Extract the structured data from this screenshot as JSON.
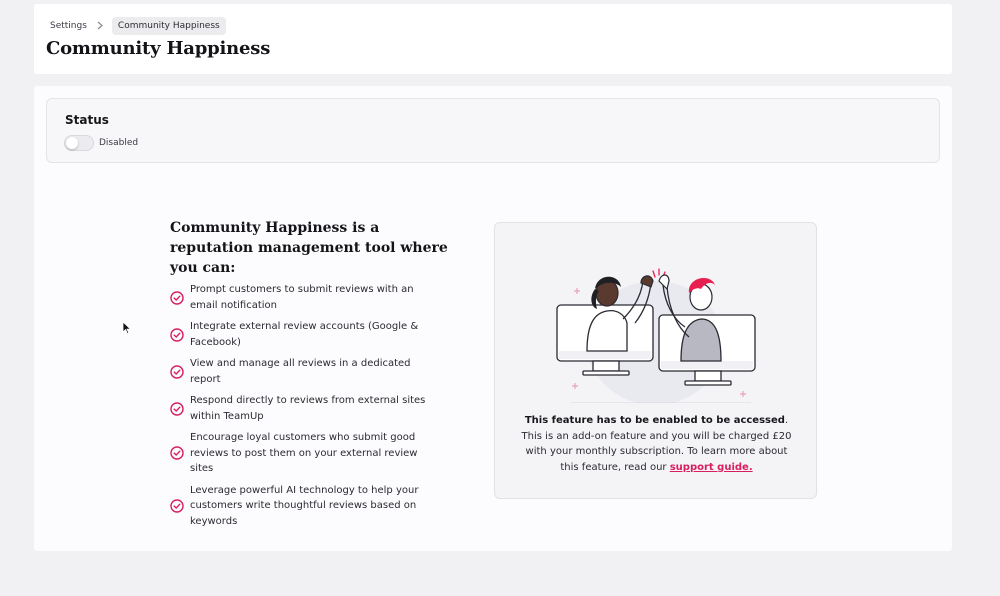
{
  "breadcrumb": {
    "parent": "Settings",
    "current": "Community Happiness"
  },
  "page_title": "Community Happiness",
  "status": {
    "title": "Status",
    "toggle_state": "Disabled",
    "enabled": false
  },
  "intro": {
    "title": "Community Happiness is a reputation management tool where you can:",
    "features": [
      "Prompt customers to submit reviews with an email notification",
      "Integrate external review accounts (Google & Facebook)",
      "View and manage all reviews in a dedicated report",
      "Respond directly to reviews from external sites within TeamUp",
      "Encourage loyal customers who submit good reviews to post them on your external review sites",
      "Leverage powerful AI technology to help your customers write thoughtful reviews based on keywords"
    ]
  },
  "info": {
    "bold": "This feature has to be enabled to be accessed",
    "body": ". This is an add-on feature and you will be charged £20 with your monthly subscription. To learn more about this feature, read our ",
    "link": "support guide."
  },
  "icons": {
    "breadcrumb_separator": "chevron-right-icon",
    "feature_bullet": "check-circle-icon",
    "illustration": "high-five-illustration",
    "pointer": "mouse-cursor-icon"
  },
  "colors": {
    "accent": "#d81f5d",
    "page_background": "#f1f1f3",
    "card_background": "#ffffff"
  }
}
